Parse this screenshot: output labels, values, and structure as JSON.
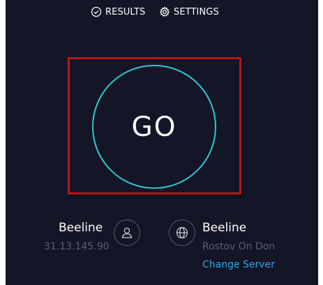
{
  "nav": {
    "results_label": "RESULTS",
    "settings_label": "SETTINGS"
  },
  "test": {
    "go_label": "GO"
  },
  "isp": {
    "name": "Beeline",
    "ip": "31.13.145.90"
  },
  "server": {
    "name": "Beeline",
    "location": "Rostov On Don",
    "change_label": "Change Server"
  },
  "icons": {
    "results": "check-circle-icon",
    "settings": "gear-icon",
    "isp": "user-icon",
    "server": "globe-icon"
  },
  "colors": {
    "background": "#141526",
    "go_ring": "#2ec9d3",
    "highlight_frame": "#b5161c",
    "link": "#2aa9e8",
    "muted_text": "#5b5e72"
  }
}
